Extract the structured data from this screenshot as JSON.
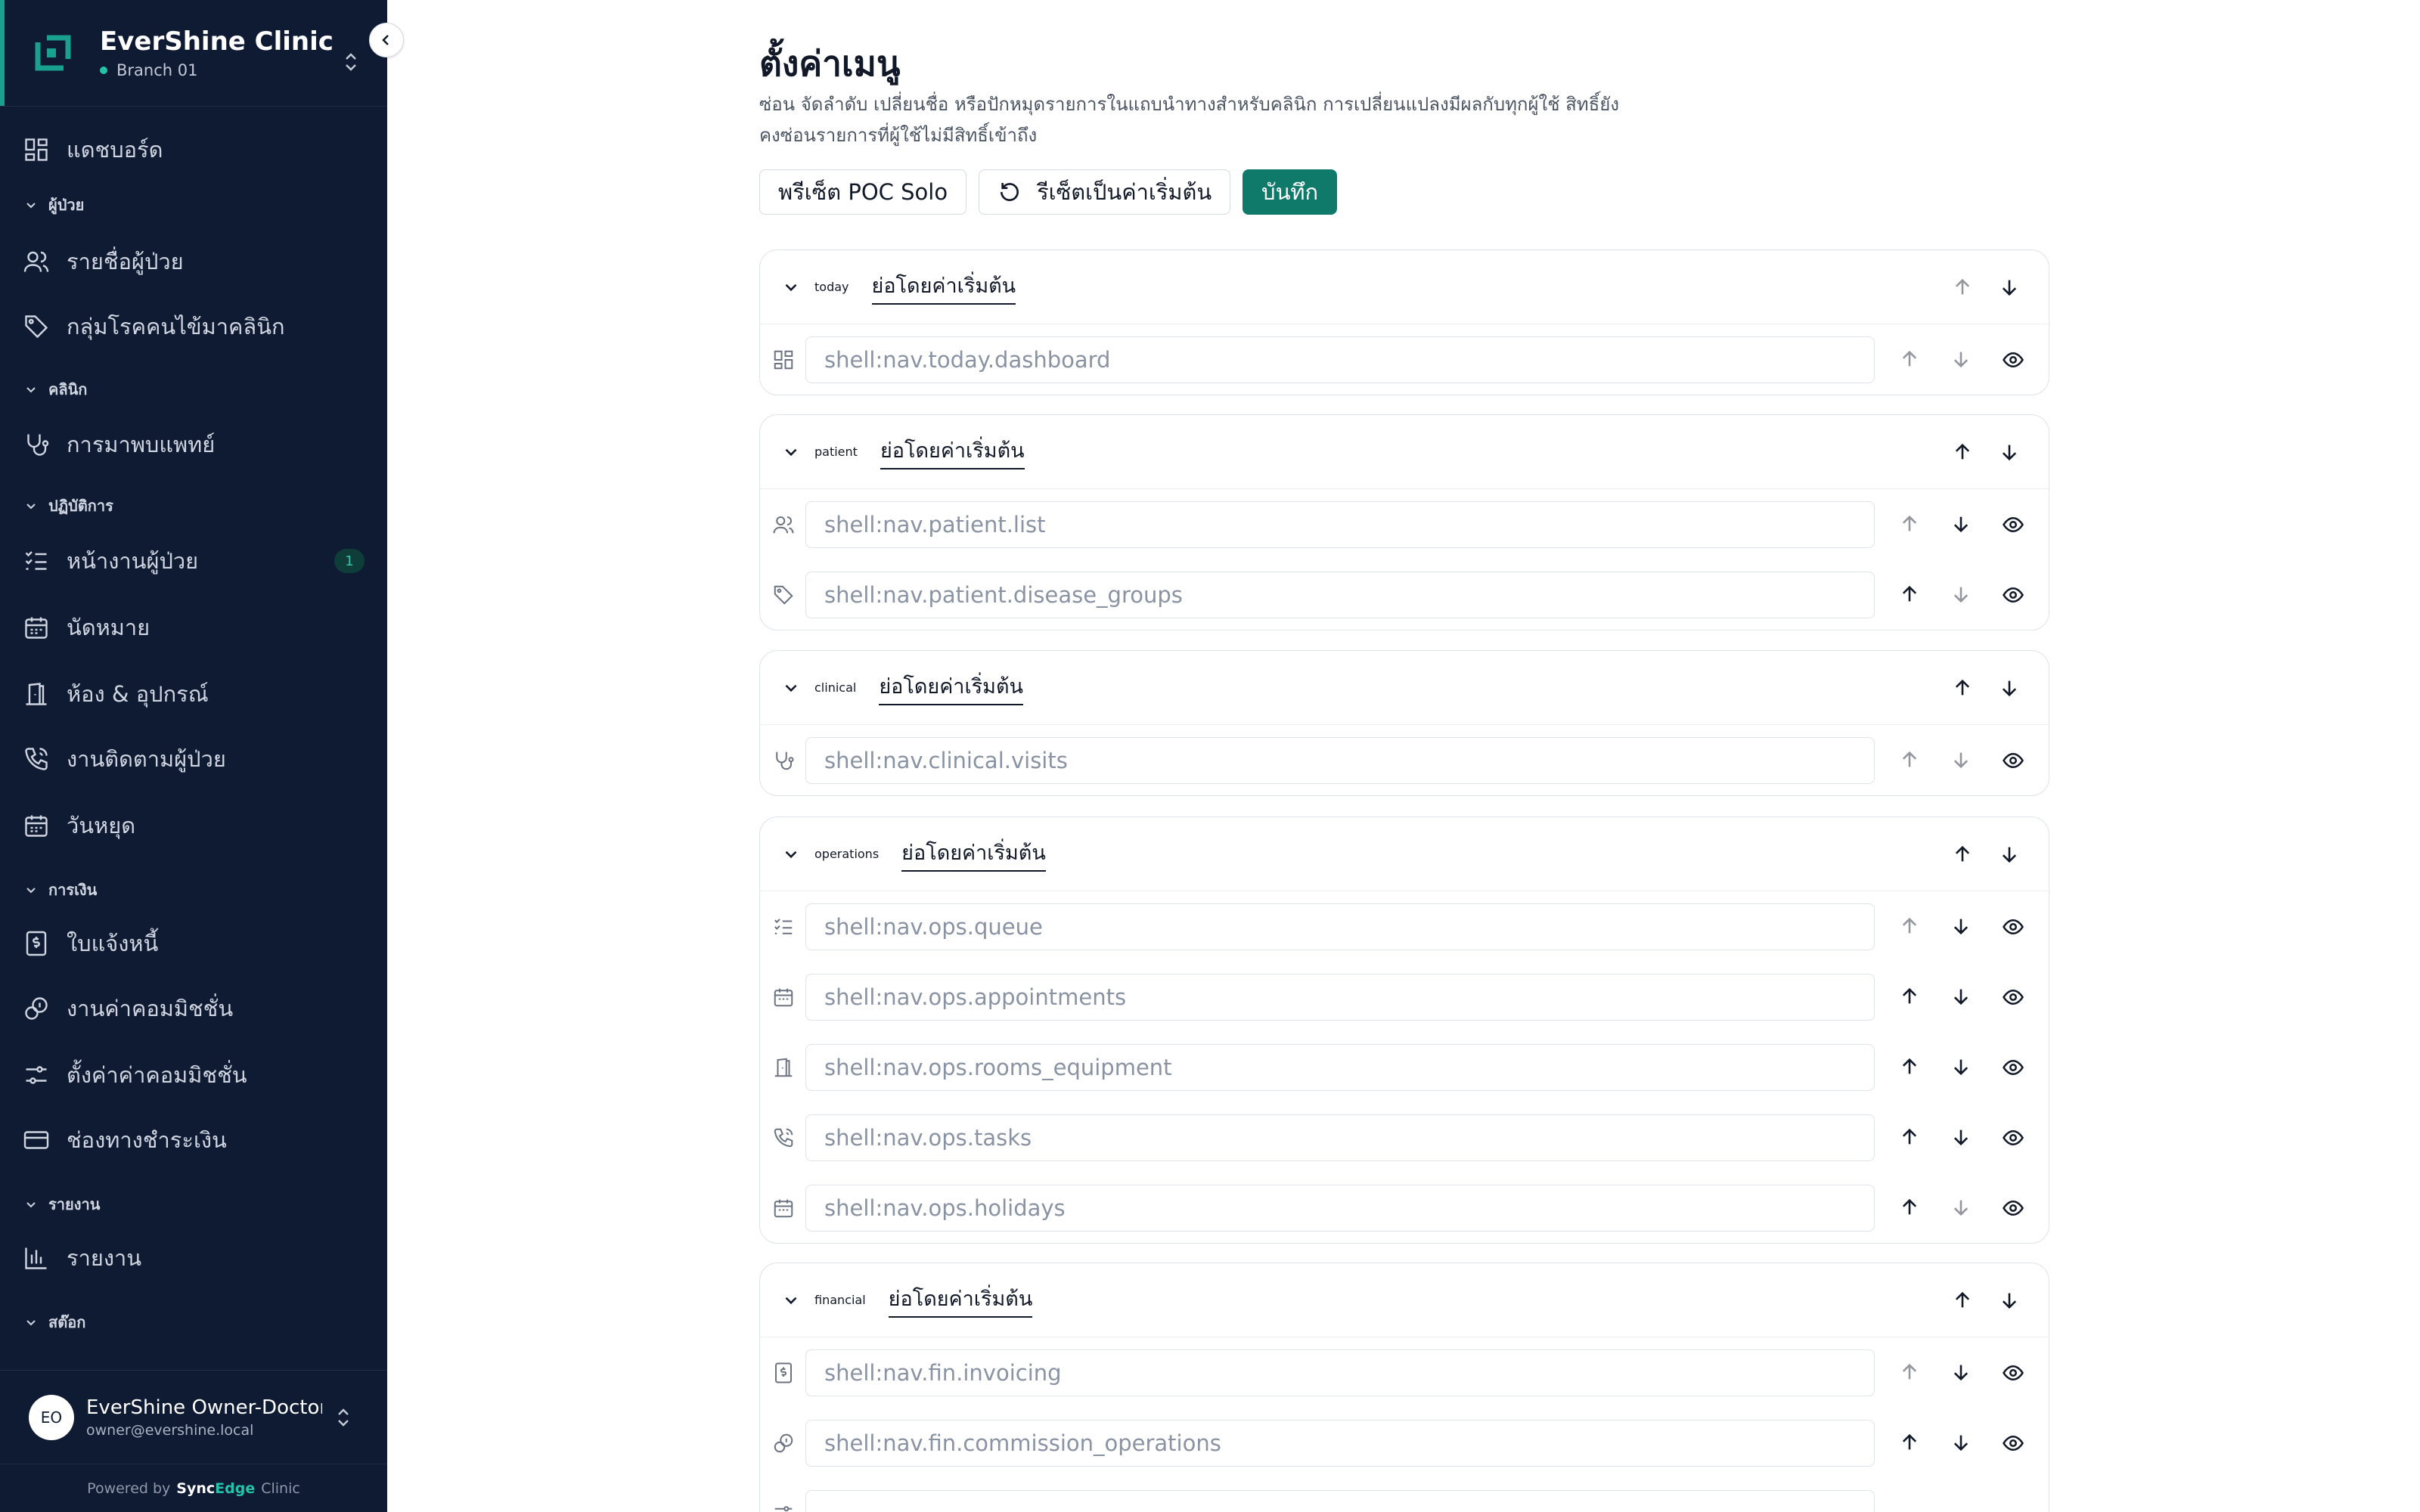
{
  "sidebar": {
    "brand_title": "EverShine Clinic",
    "branch": "Branch 01",
    "items": {
      "dashboard": "แดชบอร์ด",
      "section_patients": "ผู้ป่วย",
      "patient_list": "รายชื่อผู้ป่วย",
      "disease_groups": "กลุ่มโรคคนไข้มาคลินิก",
      "section_clinical": "คลินิก",
      "visits": "การมาพบแพทย์",
      "section_ops": "ปฏิบัติการ",
      "queue": "หน้างานผู้ป่วย",
      "queue_badge": "1",
      "appointments": "นัดหมาย",
      "rooms": "ห้อง & อุปกรณ์",
      "tasks": "งานติดตามผู้ป่วย",
      "holidays": "วันหยุด",
      "section_finance": "การเงิน",
      "invoices": "ใบแจ้งหนี้",
      "commission_ops": "งานค่าคอมมิชชั่น",
      "commission_settings": "ตั้งค่าค่าคอมมิชชั่น",
      "payment_channels": "ช่องทางชำระเงิน",
      "section_reports": "รายงาน",
      "reports": "รายงาน",
      "section_stock": "สต๊อก"
    },
    "user": {
      "initials": "EO",
      "name": "EverShine Owner-Doctor",
      "email": "owner@evershine.local"
    },
    "powered": {
      "prefix": "Powered by",
      "brand_a": "Sync",
      "brand_b": "Edge",
      "suffix": "Clinic"
    }
  },
  "main": {
    "title": "ตั้งค่าเมนู",
    "description": "ซ่อน จัดลำดับ เปลี่ยนชื่อ หรือปักหมุดรายการในแถบนำทางสำหรับคลินิก การเปลี่ยนแปลงมีผลกับทุกผู้ใช้ สิทธิ์ยังคงซ่อนรายการที่ผู้ใช้ไม่มีสิทธิ์เข้าถึง",
    "buttons": {
      "preset": "พรีเซ็ต POC Solo",
      "reset": "รีเซ็ตเป็นค่าเริ่มต้น",
      "save": "บันทึก"
    },
    "groups": {
      "today": {
        "key": "today",
        "label": "ย่อโดยค่าเริ่มต้น",
        "rows": [
          "shell:nav.today.dashboard"
        ]
      },
      "patient": {
        "key": "patient",
        "label": "ย่อโดยค่าเริ่มต้น",
        "rows": [
          "shell:nav.patient.list",
          "shell:nav.patient.disease_groups"
        ]
      },
      "clinical": {
        "key": "clinical",
        "label": "ย่อโดยค่าเริ่มต้น",
        "rows": [
          "shell:nav.clinical.visits"
        ]
      },
      "operations": {
        "key": "operations",
        "label": "ย่อโดยค่าเริ่มต้น",
        "rows": [
          "shell:nav.ops.queue",
          "shell:nav.ops.appointments",
          "shell:nav.ops.rooms_equipment",
          "shell:nav.ops.tasks",
          "shell:nav.ops.holidays"
        ]
      },
      "financial": {
        "key": "financial",
        "label": "ย่อโดยค่าเริ่มต้น",
        "rows": [
          "shell:nav.fin.invoicing",
          "shell:nav.fin.commission_operations"
        ]
      }
    }
  }
}
